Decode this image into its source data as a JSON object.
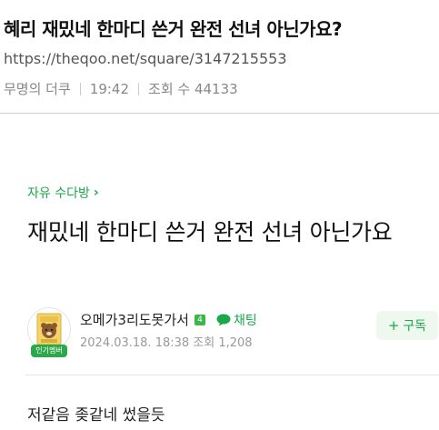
{
  "header": {
    "title": "혜리 재밌네 한마디 쓴거 완전 선녀 아닌가요?",
    "url": "https://theqoo.net/square/3147215553",
    "author": "무명의 더쿠",
    "time": "19:42",
    "views": "조회 수 44133"
  },
  "post": {
    "category": "자유 수다방",
    "category_chevron": "›",
    "title": "재밌네 한마디 쓴거 완전 선녀 아닌가요",
    "author_name": "오메가3리도못가서",
    "level": "4",
    "chat_label": "채팅",
    "avatar_badge": "인기멤버",
    "date_views": "2024.03.18. 18:38  조회 1,208",
    "subscribe_plus": "+",
    "subscribe_label": "구독",
    "body": "저같음 좆같네 썼을듯"
  },
  "colors": {
    "accent": "#1aa84a",
    "badge": "#2aa84a"
  },
  "icons": {
    "chat": "chat-bubble-icon",
    "chevron": "chevron-right-icon",
    "level": "level-badge-icon"
  }
}
